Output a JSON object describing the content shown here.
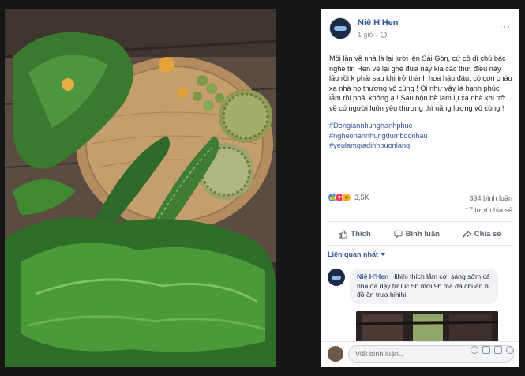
{
  "post": {
    "author": "Niê H'Hen",
    "time": "1 giờ",
    "more_icon": "···",
    "text": "Mỗi lần về nhà là lại lười lên Sài Gòn, cứ cô dì chú bác nghe tin Hen về lại ghé đưa này kia các thứ, điều này lâu rồi k phải sau khi trở thành hoa hậu đâu, có con cháu xa nhà họ thương vô cùng ! Ôi như vậy là hạnh phúc lắm rồi phải không ạ ! Sau bộn bề lam lụ xa nhà khi trở về có người luôn yêu thương thì năng lượng vô cùng !",
    "hashtags": [
      "#Dongiannhunghanhphuc",
      "#ngheonannhungdumbocnhau",
      "#yeulamgiadinhbuonlang"
    ]
  },
  "stats": {
    "reactions": "3,5K",
    "comments": "394 bình luận",
    "shares": "17 lượt chia sẻ"
  },
  "actions": {
    "like": "Thích",
    "comment": "Bình luận",
    "share": "Chia sẻ"
  },
  "comments_filter": "Liên quan nhất",
  "comment": {
    "author": "Niê H'Hen",
    "text": "Hihihi thích lắm cơ, sáng sớm cả nhà đã dậy từ lúc 5h mới 9h mà đã chuẩn bị đồ ăn trưa hihihi"
  },
  "composer": {
    "placeholder": "Viết bình luận..."
  },
  "colors": {
    "link": "#365899",
    "like": "#2d88ff",
    "love": "#f33e58",
    "wow": "#f7b125"
  }
}
